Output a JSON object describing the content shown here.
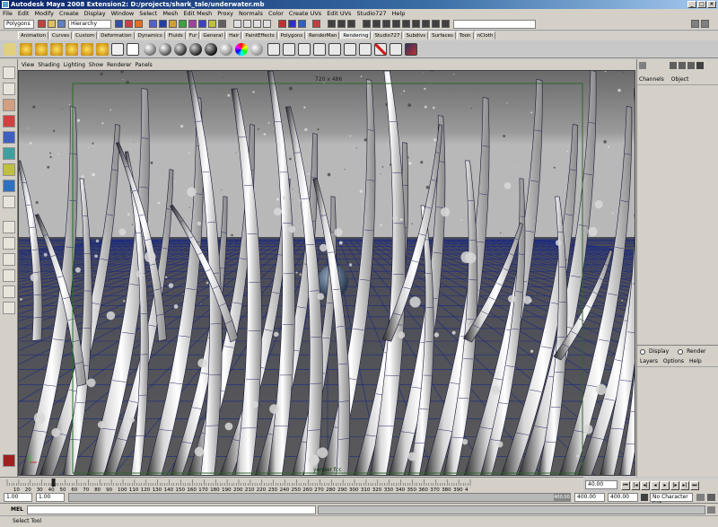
{
  "window": {
    "title": "Autodesk Maya 2008 Extension2: D:/projects/shark_tale/underwater.mb",
    "btn_min": "_",
    "btn_max": "□",
    "btn_close": "×"
  },
  "menubar": [
    "File",
    "Edit",
    "Modify",
    "Create",
    "Display",
    "Window",
    "Select",
    "Mesh",
    "Edit Mesh",
    "Proxy",
    "Normals",
    "Color",
    "Create UVs",
    "Edit UVs",
    "Studio727",
    "Help"
  ],
  "statusline": {
    "mode": "Polygons",
    "selection_mode": "Hierarchy"
  },
  "shelf": {
    "tabs": [
      "Animation",
      "Curves",
      "Custom",
      "Deformation",
      "Dynamics",
      "Fluids",
      "Fur",
      "General",
      "Hair",
      "PaintEffects",
      "Polygons",
      "RenderMan",
      "Rendering",
      "Studio727",
      "Subdivs",
      "Surfaces",
      "Toon",
      "nCloth"
    ],
    "active_tab": "Rendering"
  },
  "panel": {
    "menus": [
      "View",
      "Shading",
      "Lighting",
      "Show",
      "Renderer",
      "Panels"
    ],
    "resolution_label": "720 x 486",
    "camera_label": "yender fcc"
  },
  "channel_box": {
    "tabs": [
      "Channels",
      "Object"
    ],
    "layer_modes": [
      "Display",
      "Render"
    ],
    "layer_menus": [
      "Layers",
      "Options",
      "Help"
    ]
  },
  "timeline": {
    "ticks": [
      "10",
      "20",
      "30",
      "40",
      "50",
      "60",
      "70",
      "80",
      "90",
      "100",
      "110",
      "120",
      "130",
      "140",
      "150",
      "160",
      "170",
      "180",
      "190",
      "200",
      "210",
      "220",
      "230",
      "240",
      "250",
      "260",
      "270",
      "280",
      "290",
      "300",
      "310",
      "320",
      "330",
      "340",
      "350",
      "360",
      "370",
      "380",
      "390",
      "4"
    ],
    "current_frame": "40.00",
    "range_start": "1.00",
    "playback_start": "1.00",
    "playback_end": "400.00",
    "range_end": "400.00",
    "range_slider_label": "400.00",
    "character_set": "No Character Set"
  },
  "command_line": {
    "label": "MEL",
    "help": "Select Tool"
  },
  "colors": {
    "water_top": "#8a8a8a",
    "water_horizon": "#b8b8b8",
    "grid": "#1a2a80",
    "frame_guide": "#2a6a2a"
  }
}
